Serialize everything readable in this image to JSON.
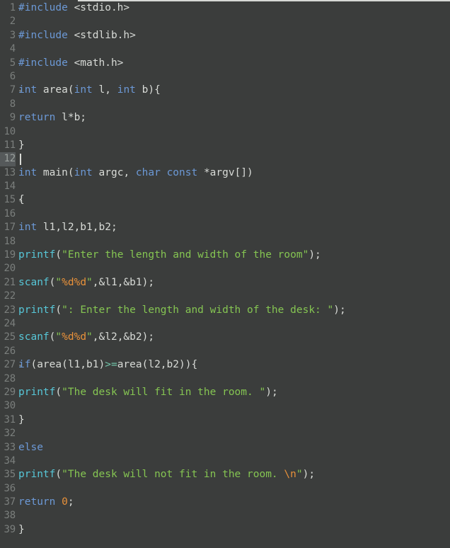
{
  "editor": {
    "name": "code-editor",
    "language": "C",
    "theme": "dark",
    "colors": {
      "background": "#3b3d3c",
      "foreground": "#d8dbd7",
      "gutter_foreground": "#7b7f7d",
      "current_line_gutter_background": "#55595a",
      "keyword": "#6c99d6",
      "function": "#57c7d8",
      "string": "#85c552",
      "escape": "#e8913a",
      "number": "#e8913a",
      "operator": "#70c2a8",
      "caret": "#d9dbd7",
      "top_rule": "#d7d9d6"
    },
    "caret": {
      "line": 12,
      "column": 1
    },
    "current_line": 12,
    "total_lines": 39,
    "fold_marker": "▾",
    "fold_lines": [
      7,
      15,
      27
    ]
  },
  "lines": [
    {
      "n": "1",
      "fold": true,
      "tokens": [
        {
          "t": "#include",
          "c": "pre"
        },
        {
          "t": " ",
          "c": "pln"
        },
        {
          "t": "<stdio.h>",
          "c": "pln"
        }
      ]
    },
    {
      "n": "2",
      "fold": false,
      "tokens": []
    },
    {
      "n": "3",
      "fold": false,
      "tokens": [
        {
          "t": "#include",
          "c": "pre"
        },
        {
          "t": " ",
          "c": "pln"
        },
        {
          "t": "<stdlib.h>",
          "c": "pln"
        }
      ]
    },
    {
      "n": "4",
      "fold": false,
      "tokens": []
    },
    {
      "n": "5",
      "fold": false,
      "tokens": [
        {
          "t": "#include",
          "c": "pre"
        },
        {
          "t": " ",
          "c": "pln"
        },
        {
          "t": "<math.h>",
          "c": "pln"
        }
      ]
    },
    {
      "n": "6",
      "fold": false,
      "tokens": []
    },
    {
      "n": "7",
      "fold": true,
      "tokens": [
        {
          "t": "int",
          "c": "kw"
        },
        {
          "t": " area(",
          "c": "pln"
        },
        {
          "t": "int",
          "c": "kw"
        },
        {
          "t": " l, ",
          "c": "pln"
        },
        {
          "t": "int",
          "c": "kw"
        },
        {
          "t": " b){",
          "c": "pln"
        }
      ]
    },
    {
      "n": "8",
      "fold": false,
      "tokens": []
    },
    {
      "n": "9",
      "fold": false,
      "tokens": [
        {
          "t": "return",
          "c": "kw"
        },
        {
          "t": " l*b;",
          "c": "pln"
        }
      ]
    },
    {
      "n": "10",
      "fold": false,
      "tokens": []
    },
    {
      "n": "11",
      "fold": false,
      "tokens": [
        {
          "t": "}",
          "c": "pln"
        }
      ]
    },
    {
      "n": "12",
      "fold": false,
      "current": true,
      "caret": true,
      "tokens": []
    },
    {
      "n": "13",
      "fold": false,
      "tokens": [
        {
          "t": "int",
          "c": "kw"
        },
        {
          "t": " main(",
          "c": "pln"
        },
        {
          "t": "int",
          "c": "kw"
        },
        {
          "t": " argc, ",
          "c": "pln"
        },
        {
          "t": "char",
          "c": "kw"
        },
        {
          "t": " ",
          "c": "pln"
        },
        {
          "t": "const",
          "c": "kw"
        },
        {
          "t": " *argv[])",
          "c": "pln"
        }
      ]
    },
    {
      "n": "14",
      "fold": false,
      "tokens": []
    },
    {
      "n": "15",
      "fold": true,
      "tokens": [
        {
          "t": "{",
          "c": "pln"
        }
      ]
    },
    {
      "n": "16",
      "fold": false,
      "tokens": []
    },
    {
      "n": "17",
      "fold": false,
      "tokens": [
        {
          "t": "int",
          "c": "kw"
        },
        {
          "t": " l1,l2,b1,b2;",
          "c": "pln"
        }
      ]
    },
    {
      "n": "18",
      "fold": false,
      "tokens": []
    },
    {
      "n": "19",
      "fold": false,
      "tokens": [
        {
          "t": "printf",
          "c": "fn"
        },
        {
          "t": "(",
          "c": "pln"
        },
        {
          "t": "\"Enter the length and width of the room\"",
          "c": "str"
        },
        {
          "t": ");",
          "c": "pln"
        }
      ]
    },
    {
      "n": "20",
      "fold": false,
      "tokens": []
    },
    {
      "n": "21",
      "fold": false,
      "tokens": [
        {
          "t": "scanf",
          "c": "fn"
        },
        {
          "t": "(",
          "c": "pln"
        },
        {
          "t": "\"",
          "c": "str"
        },
        {
          "t": "%d%d",
          "c": "esc"
        },
        {
          "t": "\"",
          "c": "str"
        },
        {
          "t": ",&l1,&b1);",
          "c": "pln"
        }
      ]
    },
    {
      "n": "22",
      "fold": false,
      "tokens": []
    },
    {
      "n": "23",
      "fold": false,
      "tokens": [
        {
          "t": "printf",
          "c": "fn"
        },
        {
          "t": "(",
          "c": "pln"
        },
        {
          "t": "\": Enter the length and width of the desk: \"",
          "c": "str"
        },
        {
          "t": ");",
          "c": "pln"
        }
      ]
    },
    {
      "n": "24",
      "fold": false,
      "tokens": []
    },
    {
      "n": "25",
      "fold": false,
      "tokens": [
        {
          "t": "scanf",
          "c": "fn"
        },
        {
          "t": "(",
          "c": "pln"
        },
        {
          "t": "\"",
          "c": "str"
        },
        {
          "t": "%d%d",
          "c": "esc"
        },
        {
          "t": "\"",
          "c": "str"
        },
        {
          "t": ",&l2,&b2);",
          "c": "pln"
        }
      ]
    },
    {
      "n": "26",
      "fold": false,
      "tokens": []
    },
    {
      "n": "27",
      "fold": true,
      "tokens": [
        {
          "t": "if",
          "c": "kw"
        },
        {
          "t": "(area(l1,b1)",
          "c": "pln"
        },
        {
          "t": ">=",
          "c": "op"
        },
        {
          "t": "area(l2,b2)){",
          "c": "pln"
        }
      ]
    },
    {
      "n": "28",
      "fold": false,
      "tokens": []
    },
    {
      "n": "29",
      "fold": false,
      "tokens": [
        {
          "t": "printf",
          "c": "fn"
        },
        {
          "t": "(",
          "c": "pln"
        },
        {
          "t": "\"The desk will fit in the room. \"",
          "c": "str"
        },
        {
          "t": ");",
          "c": "pln"
        }
      ]
    },
    {
      "n": "30",
      "fold": false,
      "tokens": []
    },
    {
      "n": "31",
      "fold": false,
      "tokens": [
        {
          "t": "}",
          "c": "pln"
        }
      ]
    },
    {
      "n": "32",
      "fold": false,
      "tokens": []
    },
    {
      "n": "33",
      "fold": false,
      "tokens": [
        {
          "t": "else",
          "c": "kw"
        }
      ]
    },
    {
      "n": "34",
      "fold": false,
      "tokens": []
    },
    {
      "n": "35",
      "fold": false,
      "tokens": [
        {
          "t": "printf",
          "c": "fn"
        },
        {
          "t": "(",
          "c": "pln"
        },
        {
          "t": "\"The desk will not fit in the room. ",
          "c": "str"
        },
        {
          "t": "\\n",
          "c": "esc"
        },
        {
          "t": "\"",
          "c": "str"
        },
        {
          "t": ");",
          "c": "pln"
        }
      ]
    },
    {
      "n": "36",
      "fold": false,
      "tokens": []
    },
    {
      "n": "37",
      "fold": false,
      "tokens": [
        {
          "t": "return",
          "c": "kw"
        },
        {
          "t": " ",
          "c": "pln"
        },
        {
          "t": "0",
          "c": "num"
        },
        {
          "t": ";",
          "c": "pln"
        }
      ]
    },
    {
      "n": "38",
      "fold": false,
      "tokens": []
    },
    {
      "n": "39",
      "fold": false,
      "tokens": [
        {
          "t": "}",
          "c": "pln"
        }
      ]
    }
  ]
}
